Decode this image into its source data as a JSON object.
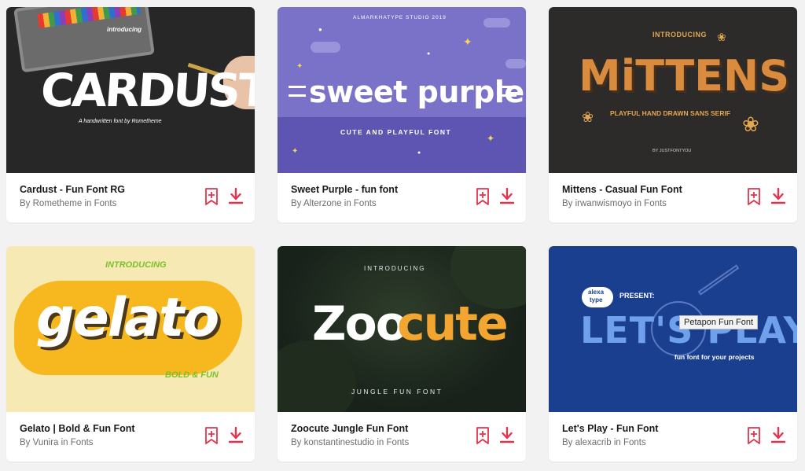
{
  "colors": {
    "accent": "#e5334d",
    "page_bg": "#f2f2f2"
  },
  "cards": [
    {
      "title": "Cardust - Fun Font RG",
      "byline": "By Rometheme in Fonts",
      "preview": {
        "intro": "introducing",
        "headline": "CARDUST",
        "tagline": "A handwritten font by Rometheme"
      }
    },
    {
      "title": "Sweet Purple - fun font",
      "byline": "By Alterzone in Fonts",
      "preview": {
        "studio": "ALMARKHATYPE STUDIO 2019",
        "headline": "sweet purple",
        "tagline": "CUTE AND PLAYFUL FONT"
      }
    },
    {
      "title": "Mittens - Casual Fun Font",
      "byline": "By irwanwismoyo in Fonts",
      "preview": {
        "intro": "INTRODUCING",
        "headline": "MiTTENS",
        "tagline": "PLAYFUL HAND DRAWN SANS SERIF",
        "credit": "BY JUSTFONTYOU"
      }
    },
    {
      "title": "Gelato | Bold & Fun Font",
      "byline": "By Vunira in Fonts",
      "preview": {
        "intro": "INTRODUCING",
        "headline": "gelato",
        "tagline": "BOLD & FUN"
      }
    },
    {
      "title": "Zoocute Jungle Fun Font",
      "byline": "By konstantinestudio in Fonts",
      "preview": {
        "intro": "INTRODUCING",
        "headline_a": "Zoo",
        "headline_b": "cute",
        "tagline": "JUNGLE FUN FONT"
      }
    },
    {
      "title": "Let's Play - Fun Font",
      "byline": "By alexacrib in Fonts",
      "preview": {
        "logo_line1": "alexa",
        "logo_line2": "type",
        "present": "PRESENT:",
        "headline": "LET'S PLAY",
        "tagline": "fun font for your projects"
      }
    }
  ],
  "tooltip": "Petapon Fun Font",
  "icons": {
    "bookmark": "bookmark-add-icon",
    "download": "download-icon"
  }
}
